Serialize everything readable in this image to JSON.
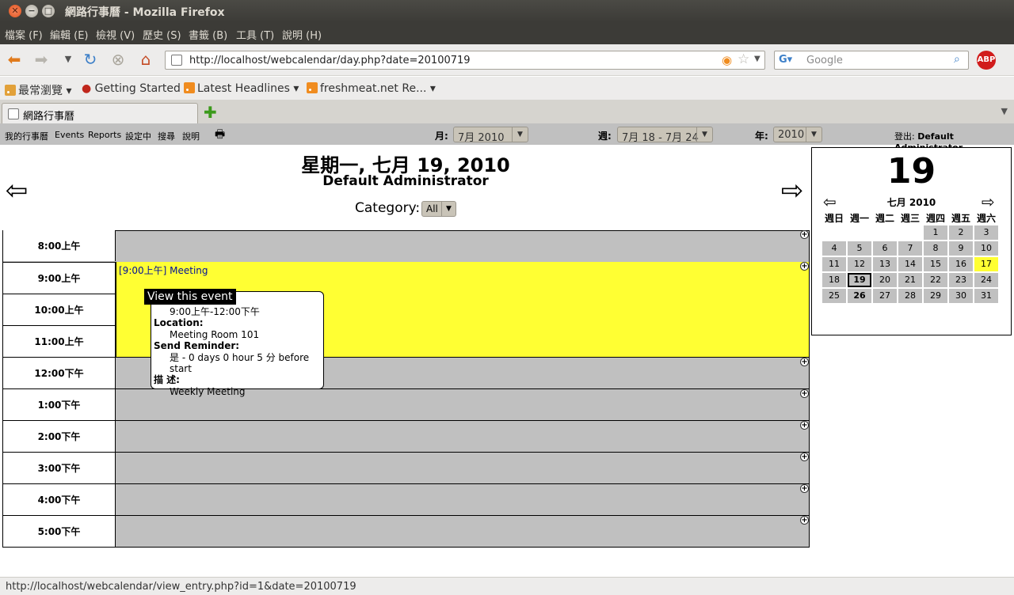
{
  "window": {
    "title": "網路行事曆 - Mozilla Firefox",
    "menu": [
      "檔案 (F)",
      "編輯 (E)",
      "檢視 (V)",
      "歷史 (S)",
      "書籤 (B)",
      "工具 (T)",
      "說明 (H)"
    ]
  },
  "nav": {
    "url": "http://localhost/webcalendar/day.php?date=20100719",
    "search_placeholder": "Google"
  },
  "bookmarks": [
    "最常瀏覽",
    "Getting Started",
    "Latest Headlines",
    "freshmeat.net Re..."
  ],
  "tabs": [
    {
      "label": "網路行事曆"
    }
  ],
  "wc_menu": {
    "items": [
      "我的行事曆",
      "Events",
      "Reports",
      "設定中",
      "搜尋",
      "說明"
    ],
    "month_label": "月:",
    "month_value": "7月 2010",
    "week_label": "週:",
    "week_value": "7月 18 - 7月 24",
    "year_label": "年:",
    "year_value": "2010",
    "logout_label": "登出:",
    "logout_user": "Default Administrator"
  },
  "day": {
    "title": "星期一, 七月 19, 2010",
    "user": "Default Administrator",
    "category_label": "Category:",
    "category_value": "All",
    "times": [
      "8:00上午",
      "9:00上午",
      "10:00上午",
      "11:00上午",
      "12:00下午",
      "1:00下午",
      "2:00下午",
      "3:00下午",
      "4:00下午",
      "5:00下午"
    ],
    "event": {
      "label": "[9:00上午] Meeting"
    }
  },
  "tooltip": {
    "header": "View this event",
    "time": "9:00上午-12:00下午",
    "location_label": "Location:",
    "location": "Meeting Room 101",
    "reminder_label": "Send Reminder:",
    "reminder": "是 - 0 days 0 hour 5 分 before start",
    "desc_label": "描 述:",
    "desc": "Weekly Meeting"
  },
  "mini": {
    "big_day": "19",
    "month_title": "七月 2010",
    "weekdays": [
      "週日",
      "週一",
      "週二",
      "週三",
      "週四",
      "週五",
      "週六"
    ],
    "weeks": [
      [
        "",
        "",
        "",
        "",
        "1",
        "2",
        "3"
      ],
      [
        "4",
        "5",
        "6",
        "7",
        "8",
        "9",
        "10"
      ],
      [
        "11",
        "12",
        "13",
        "14",
        "15",
        "16",
        "17"
      ],
      [
        "18",
        "19",
        "20",
        "21",
        "22",
        "23",
        "24"
      ],
      [
        "25",
        "26",
        "27",
        "28",
        "29",
        "30",
        "31"
      ]
    ],
    "today": "19",
    "bold_days": [
      "19",
      "26"
    ],
    "highlight_day": "17"
  },
  "status": "http://localhost/webcalendar/view_entry.php?id=1&date=20100719",
  "colors": {
    "event_bg": "#ffff33",
    "slot_bg": "#c0c0c0",
    "link": "#000f99"
  }
}
